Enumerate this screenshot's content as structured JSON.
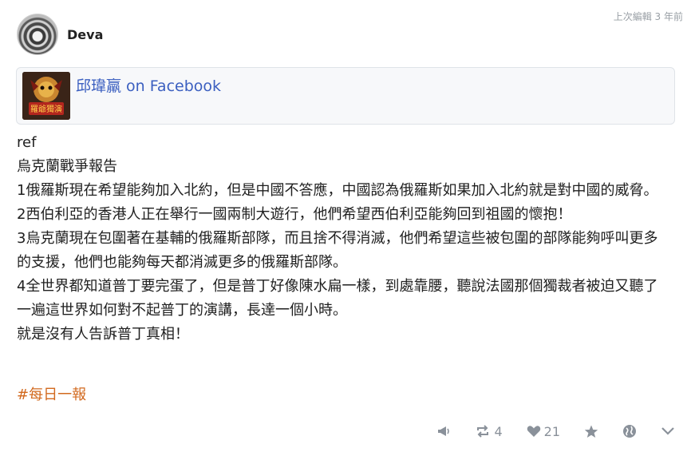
{
  "post": {
    "author": "Deva",
    "edited_label": "上次編輯 3 年前",
    "link_card": {
      "title": "邱瑋羸 on Facebook",
      "thumb_text": "羅爺獨演"
    },
    "paragraphs": [
      "ref",
      "烏克蘭戰爭報告",
      "1俄羅斯現在希望能夠加入北約，但是中國不答應，中國認為俄羅斯如果加入北約就是對中國的威脅。",
      "2西伯利亞的香港人正在舉行一國兩制大遊行，他們希望西伯利亞能夠回到祖國的懷抱！",
      "3烏克蘭現在包圍著在基輔的俄羅斯部隊，而且捨不得消滅，他們希望這些被包圍的部隊能夠呼叫更多的支援，他們也能夠每天都消滅更多的俄羅斯部隊。",
      "4全世界都知道普丁要完蛋了，但是普丁好像陳水扁一樣，到處靠腰，聽說法國那個獨裁者被迫又聽了一遍這世界如何對不起普丁的演講，長達一個小時。",
      "就是沒有人告訴普丁真相！"
    ],
    "hashtag": "#每日一報"
  },
  "actions": {
    "boost_count": "4",
    "like_count": "21",
    "icons": [
      "megaphone-icon",
      "boost-icon",
      "heart-icon",
      "star-icon",
      "globe-icon",
      "chevron-down-icon"
    ]
  },
  "colors": {
    "link": "#3b5fc0",
    "hashtag": "#d2691e",
    "muted": "#8a919a"
  }
}
